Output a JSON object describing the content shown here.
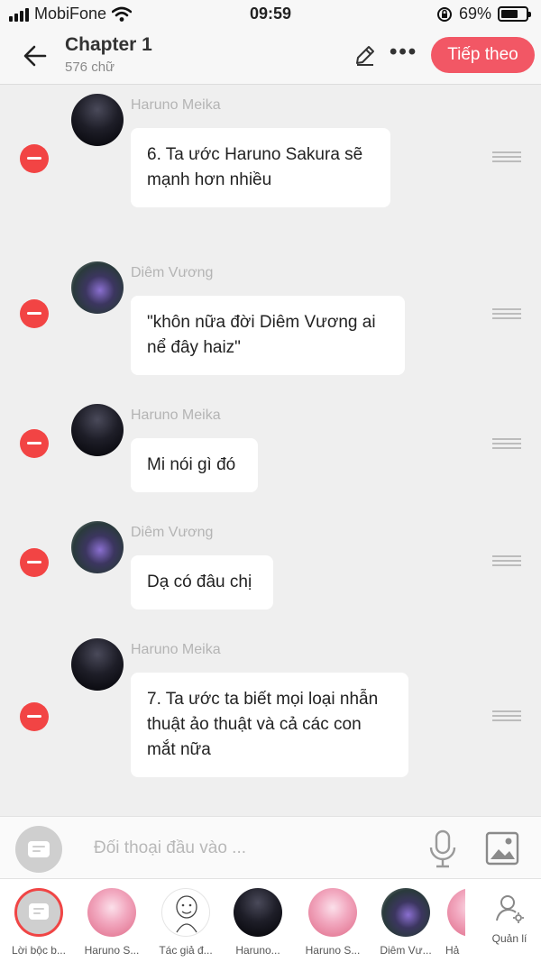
{
  "status_bar": {
    "carrier": "MobiFone",
    "time": "09:59",
    "battery": "69%",
    "battery_level": 0.69,
    "icons": [
      "signal-icon",
      "wifi-icon",
      "rotation-lock-icon",
      "battery-icon"
    ]
  },
  "header": {
    "title": "Chapter 1",
    "word_count": "576 chữ",
    "next_label": "Tiếp theo",
    "accent_color": "#f25765",
    "icons": [
      "back-arrow-icon",
      "pencil-icon",
      "more-icon"
    ]
  },
  "messages": [
    {
      "speaker": "Haruno Meika",
      "text_lines": [
        "6. Ta ước Haruno Sakura sẽ",
        "mạnh hơn nhiều"
      ]
    },
    {
      "speaker": "Diêm Vương",
      "text_lines": [
        "\"khôn nữa đời Diêm Vương ai",
        "nể đây haiz\""
      ]
    },
    {
      "speaker": "Haruno Meika",
      "text_lines": [
        "Mi nói gì đó"
      ]
    },
    {
      "speaker": "Diêm Vương",
      "text_lines": [
        "Dạ có đâu chị"
      ]
    },
    {
      "speaker": "Haruno Meika",
      "text_lines": [
        "7. Ta ước ta biết mọi loại nhẫn",
        "thuật ảo thuật và cả các con",
        "mắt nữa"
      ]
    }
  ],
  "input": {
    "placeholder": "Đối thoại đầu vào ...",
    "icons": [
      "narrator-icon",
      "microphone-icon",
      "image-icon"
    ]
  },
  "characters": [
    {
      "label": "Lời bộc b...",
      "selected": true
    },
    {
      "label": "Haruno S..."
    },
    {
      "label": "Tác giả đ..."
    },
    {
      "label": "Haruno..."
    },
    {
      "label": "Haruno S..."
    },
    {
      "label": "Diêm Vư..."
    },
    {
      "label": "Hả"
    }
  ],
  "manage_label": "Quản lí",
  "delete_color": "#f24444"
}
